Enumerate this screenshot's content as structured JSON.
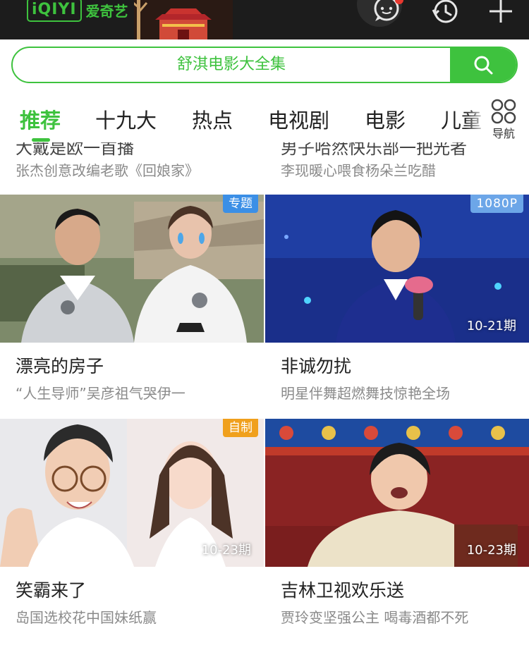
{
  "header": {
    "logo_mark": "iQIYI",
    "logo_text": "爱奇艺",
    "icons": [
      "chat-bubble-icon",
      "history-clock-icon",
      "plus-icon"
    ]
  },
  "search": {
    "placeholder": "舒淇电影大全集",
    "button_icon": "search-icon"
  },
  "tabs": {
    "items": [
      "推荐",
      "十九大",
      "热点",
      "电视剧",
      "电影",
      "儿童"
    ],
    "active": "推荐",
    "nav_label": "导航"
  },
  "feed": {
    "previous_row": {
      "left_title_fragment": "大戴是欧一首播",
      "right_title_fragment": "男子哈然快乐部一把光者",
      "left_subtitle": "张杰创意改编老歌《回娘家》",
      "right_subtitle": "李现暖心喂食杨朵兰吃醋"
    },
    "cards": [
      {
        "title": "漂亮的房子",
        "subtitle": "“人生导师”吴彦祖气哭伊一",
        "badge": "专题",
        "episode": ""
      },
      {
        "title": "非诚勿扰",
        "subtitle": "明星伴舞超燃舞技惊艳全场",
        "badge": "1080P",
        "episode": "10-21期"
      },
      {
        "title": "笑霸来了",
        "subtitle": "岛国选校花中国妹纸赢",
        "badge": "自制",
        "episode": "10-23期"
      },
      {
        "title": "吉林卫视欢乐送",
        "subtitle": "贾玲变坚强公主 喝毒酒都不死",
        "badge": "",
        "episode": "10-23期"
      }
    ]
  },
  "colors": {
    "brand_green": "#3ec23e",
    "badge_blue": "#3b8fe6",
    "badge_orange": "#f0a01d",
    "header_bg": "#1c1c1c"
  }
}
